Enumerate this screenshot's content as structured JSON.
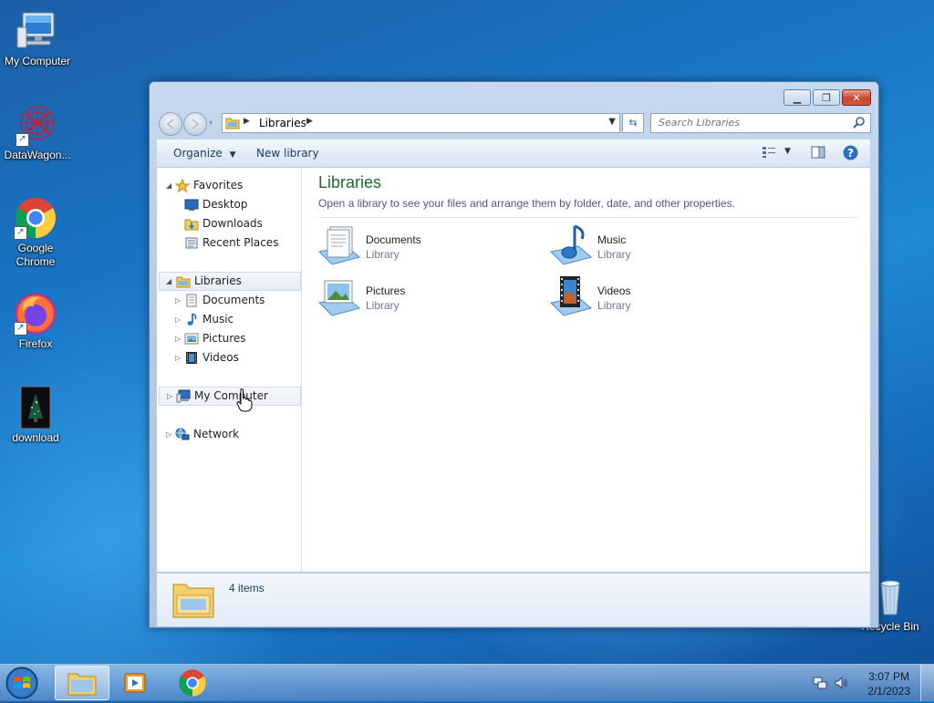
{
  "desktop": {
    "icons": [
      {
        "label": "My Computer"
      },
      {
        "label": "DataWagon..."
      },
      {
        "label": "Google Chrome"
      },
      {
        "label": "Firefox"
      },
      {
        "label": "download"
      },
      {
        "label": "Recycle Bin"
      }
    ]
  },
  "window": {
    "address": {
      "crumb": "Libraries"
    },
    "search": {
      "placeholder": "Search Libraries"
    },
    "toolbar": {
      "organize": "Organize",
      "new_library": "New library"
    },
    "nav_pane": {
      "favorites": "Favorites",
      "favorites_items": [
        "Desktop",
        "Downloads",
        "Recent Places"
      ],
      "libraries": "Libraries",
      "libraries_items": [
        "Documents",
        "Music",
        "Pictures",
        "Videos"
      ],
      "my_computer": "My Computer",
      "network": "Network"
    },
    "content": {
      "heading": "Libraries",
      "subtitle": "Open a library to see your files and arrange them by folder, date, and other properties.",
      "items": [
        {
          "name": "Documents",
          "type": "Library"
        },
        {
          "name": "Music",
          "type": "Library"
        },
        {
          "name": "Pictures",
          "type": "Library"
        },
        {
          "name": "Videos",
          "type": "Library"
        }
      ]
    },
    "details": {
      "count": "4 items"
    }
  },
  "taskbar": {
    "time": "3:07 PM",
    "date": "2/1/2023"
  },
  "colors": {
    "heading_green": "#1e6a2c",
    "close_red": "#c7452c",
    "desktop_blue": "#1a78c8"
  }
}
